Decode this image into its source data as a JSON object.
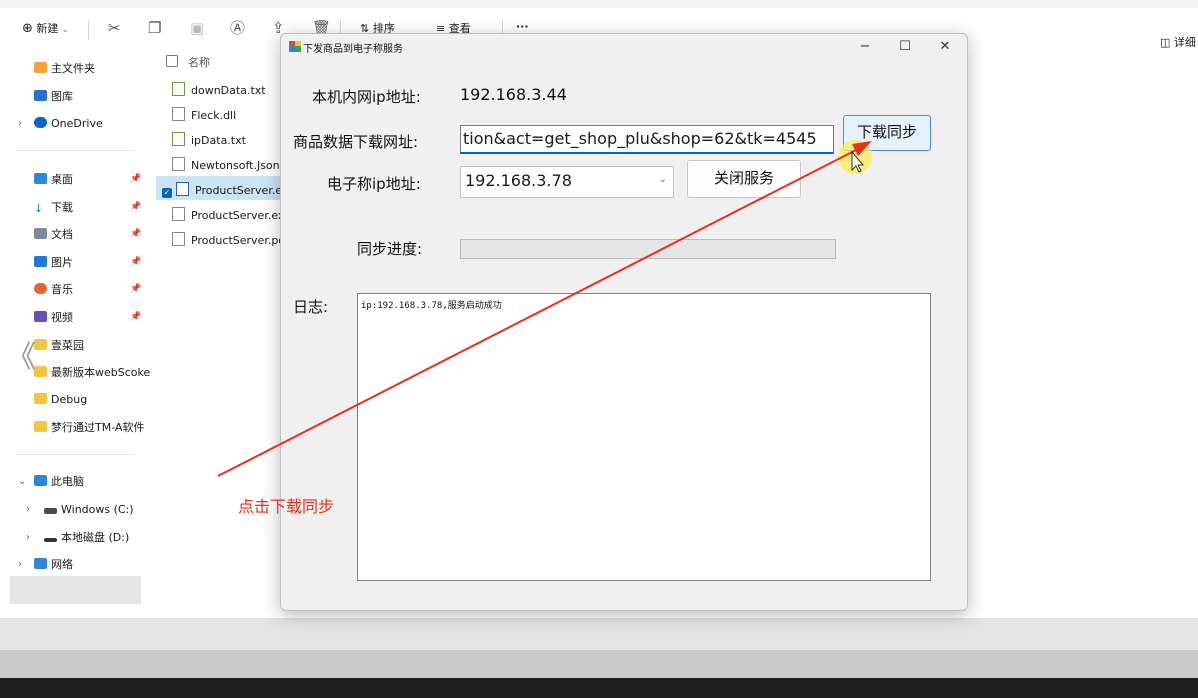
{
  "explorer": {
    "toolbar": {
      "new_label": "新建",
      "sort_label": "排序",
      "view_label": "查看",
      "more_label": "···",
      "details_label": "详细"
    },
    "nav": {
      "home": "主文件夹",
      "gallery": "图库",
      "onedrive": "OneDrive",
      "desktop": "桌面",
      "downloads": "下载",
      "documents": "文档",
      "pictures": "图片",
      "music": "音乐",
      "videos": "视频",
      "folder1": "壹菜园",
      "folder2": "最新版本webScoke",
      "folder3": "Debug",
      "folder4": "梦行通过TM-A软件",
      "this_pc": "此电脑",
      "drive_c": "Windows (C:)",
      "drive_d": "本地磁盘 (D:)",
      "network": "网络"
    },
    "files": {
      "header": "名称",
      "items": [
        "downData.txt",
        "Fleck.dll",
        "ipData.txt",
        "Newtonsoft.Json.d",
        "ProductServer.exe",
        "ProductServer.exe",
        "ProductServer.pdb"
      ]
    }
  },
  "dialog": {
    "title": "下发商品到电子称服务",
    "local_ip_label": "本机内网ip地址:",
    "local_ip_value": "192.168.3.44",
    "url_label": "商品数据下载网址:",
    "url_value": "tion&act=get_shop_plu&shop=62&tk=4545",
    "download_button": "下载同步",
    "scale_ip_label": "电子称ip地址:",
    "scale_ip_value": "192.168.3.78",
    "close_service_button": "关闭服务",
    "progress_label": "同步进度:",
    "progress_value": 0,
    "log_label": "日志:",
    "log_text": "ip:192.168.3.78,服务启动成功"
  },
  "annotation": {
    "text": "点击下载同步",
    "color": "#e8301c"
  },
  "colors": {
    "accent": "#0067c0",
    "dialog_bg": "#f0f0f0",
    "annotation": "#e8301c"
  }
}
